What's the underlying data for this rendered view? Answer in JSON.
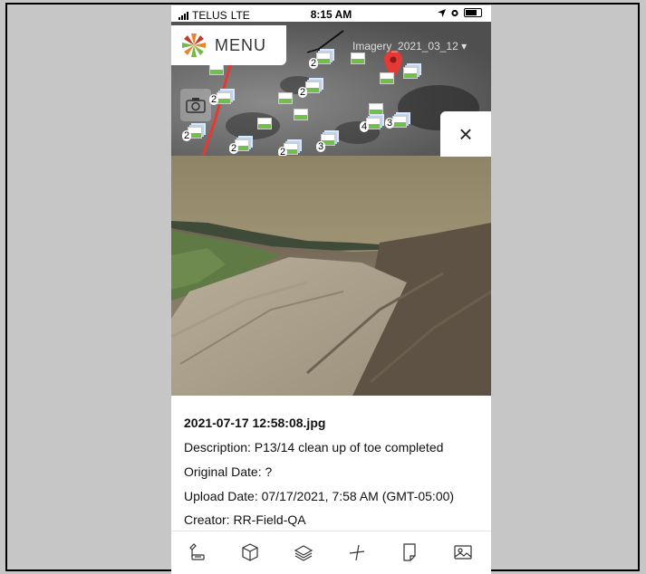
{
  "status_bar": {
    "carrier": "TELUS",
    "network": "LTE",
    "time": "8:15 AM"
  },
  "map": {
    "menu_label": "MENU",
    "imagery_selector": "Imagery_2021_03_12",
    "cluster_counts": [
      "2",
      "2",
      "2",
      "2",
      "2",
      "3",
      "2",
      "4",
      "3"
    ]
  },
  "close_button_symbol": "×",
  "photo": {
    "filename": "2021-07-17 12:58:08.jpg",
    "description": "Description: P13/14 clean up of toe completed",
    "original_date": "Original Date: ?",
    "upload_date": "Upload Date: 07/17/2021, 7:58 AM (GMT-05:00)",
    "creator": "Creator: RR-Field-QA"
  },
  "toolbar_icons": [
    "measure-icon",
    "cube-icon",
    "layers-icon",
    "vertex-icon",
    "note-icon",
    "image-icon"
  ],
  "colors": {
    "accent_red": "#e53935",
    "logo_orange": "#e8862c",
    "logo_green": "#7ab648",
    "thumb_green": "#6fbf4a"
  }
}
